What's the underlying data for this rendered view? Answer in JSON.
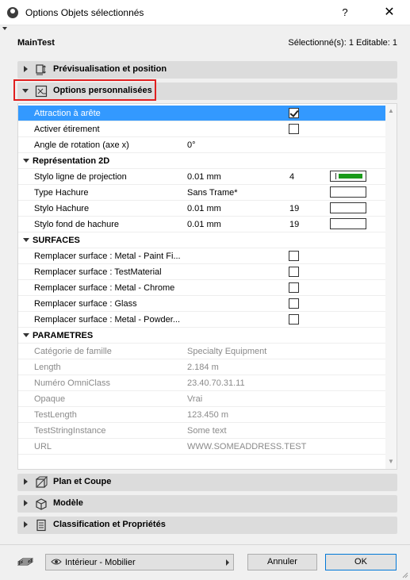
{
  "window": {
    "title": "Options Objets sélectionnés",
    "help_label": "?",
    "close_label": "✕"
  },
  "header": {
    "object_name": "MainTest",
    "selection_status": "Sélectionné(s): 1 Editable: 1"
  },
  "sections": {
    "preview": "Prévisualisation et position",
    "custom": "Options personnalisées",
    "plan": "Plan et Coupe",
    "model": "Modèle",
    "classification": "Classification et Propriétés"
  },
  "rows": {
    "attraction": {
      "label": "Attraction à arête",
      "checked": true
    },
    "stretch": {
      "label": "Activer étirement",
      "checked": false
    },
    "rotation": {
      "label": "Angle de rotation (axe x)",
      "value": "0°"
    },
    "rep2d": "Représentation 2D",
    "pen_proj": {
      "label": "Stylo ligne de projection",
      "value": "0.01 mm",
      "pen": "4"
    },
    "hatch_type": {
      "label": "Type Hachure",
      "value": "Sans Trame*"
    },
    "hatch_pen": {
      "label": "Stylo Hachure",
      "value": "0.01 mm",
      "pen": "19"
    },
    "hatch_bg": {
      "label": "Stylo fond de hachure",
      "value": "0.01 mm",
      "pen": "19"
    },
    "surfaces": "SURFACES",
    "surf1": "Remplacer surface : Metal - Paint Fi...",
    "surf2": "Remplacer surface : TestMaterial",
    "surf3": "Remplacer surface : Metal - Chrome",
    "surf4": "Remplacer surface : Glass",
    "surf5": "Remplacer surface : Metal - Powder...",
    "params": "PARAMETRES",
    "p1": {
      "label": "Catégorie de famille",
      "value": "Specialty Equipment"
    },
    "p2": {
      "label": "Length",
      "value": "2.184 m"
    },
    "p3": {
      "label": "Numéro OmniClass",
      "value": "23.40.70.31.11"
    },
    "p4": {
      "label": "Opaque",
      "value": "Vrai"
    },
    "p5": {
      "label": "TestLength",
      "value": "123.450 m"
    },
    "p6": {
      "label": "TestStringInstance",
      "value": "Some text"
    },
    "p7": {
      "label": "URL",
      "value": "WWW.SOMEADDRESS.TEST"
    }
  },
  "footer": {
    "layer": "Intérieur - Mobilier",
    "cancel": "Annuler",
    "ok": "OK"
  },
  "colors": {
    "selection": "#3399ff",
    "pen_swatch": "#1a9a1a",
    "highlight": "#e02020"
  }
}
